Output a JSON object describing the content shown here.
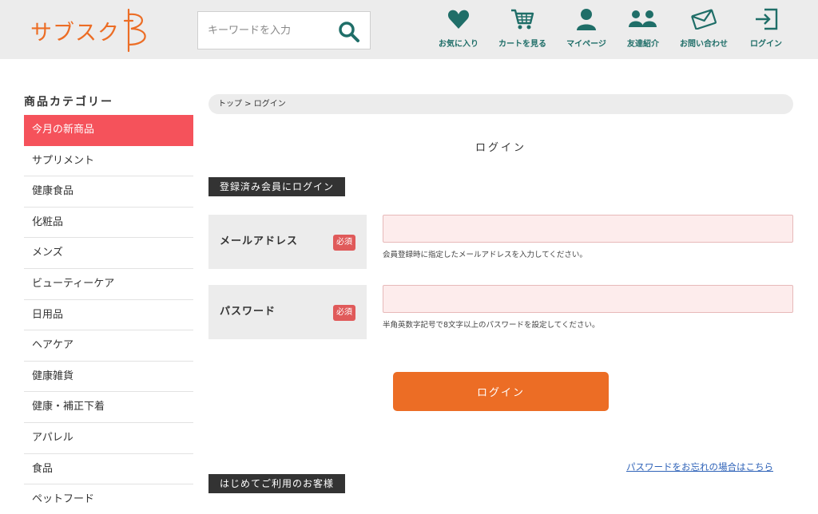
{
  "header": {
    "logo_text": "サブスク",
    "brand_color": "#ec6d25",
    "search": {
      "placeholder": "キーワードを入力",
      "value": ""
    },
    "nav": [
      {
        "label": "お気に入り",
        "icon": "heart-icon"
      },
      {
        "label": "カートを見る",
        "icon": "cart-icon"
      },
      {
        "label": "マイページ",
        "icon": "person-icon"
      },
      {
        "label": "友達紹介",
        "icon": "two-people-icon"
      },
      {
        "label": "お問い合わせ",
        "icon": "envelope-icon"
      },
      {
        "label": "ログイン",
        "icon": "login-icon"
      }
    ],
    "nav_color": "#1f6e68"
  },
  "sidebar": {
    "title": "商品カテゴリー",
    "active_color": "#f5525b",
    "items": [
      {
        "label": "今月の新商品",
        "active": true
      },
      {
        "label": "サプリメント"
      },
      {
        "label": "健康食品"
      },
      {
        "label": "化粧品"
      },
      {
        "label": "メンズ"
      },
      {
        "label": "ビューティーケア"
      },
      {
        "label": "日用品"
      },
      {
        "label": "ヘアケア"
      },
      {
        "label": "健康雑貨"
      },
      {
        "label": "健康・補正下着"
      },
      {
        "label": "アパレル"
      },
      {
        "label": "食品"
      },
      {
        "label": "ペットフード"
      }
    ]
  },
  "main": {
    "breadcrumb": {
      "home": "トップ",
      "separator": " > ",
      "current": "ログイン"
    },
    "page_title": "ログイン",
    "registered_section": "登録済み会員にログイン",
    "fields": {
      "email": {
        "label": "メールアドレス",
        "required": "必須",
        "value": "",
        "help": "会員登録時に指定したメールアドレスを入力してください。"
      },
      "password": {
        "label": "パスワード",
        "required": "必須",
        "value": "",
        "help": "半角英数字記号で8文字以上のパスワードを設定してください。"
      }
    },
    "login_button": "ログイン",
    "forgot_link": "パスワードをお忘れの場合はこちら",
    "first_time_section": "はじめてご利用のお客様"
  }
}
